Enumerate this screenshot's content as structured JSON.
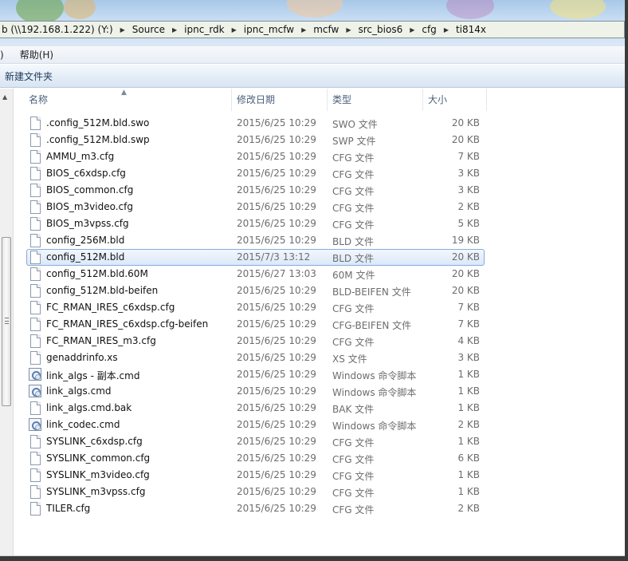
{
  "address": {
    "crumbs": [
      "b (\\\\192.168.1.222) (Y:)",
      "Source",
      "ipnc_rdk",
      "ipnc_mcfw",
      "mcfw",
      "src_bios6",
      "cfg",
      "ti814x"
    ]
  },
  "menu": {
    "partial": ")",
    "help": "帮助(H)"
  },
  "toolbar": {
    "new_folder": "新建文件夹"
  },
  "columns": {
    "name": "名称",
    "date": "修改日期",
    "type": "类型",
    "size": "大小"
  },
  "files": [
    {
      "name": ".config_512M.bld.swo",
      "date": "2015/6/25 10:29",
      "type": "SWO 文件",
      "size": "20 KB",
      "icon": "file-icon"
    },
    {
      "name": ".config_512M.bld.swp",
      "date": "2015/6/25 10:29",
      "type": "SWP 文件",
      "size": "20 KB",
      "icon": "file-icon"
    },
    {
      "name": "AMMU_m3.cfg",
      "date": "2015/6/25 10:29",
      "type": "CFG 文件",
      "size": "7 KB",
      "icon": "file-icon"
    },
    {
      "name": "BIOS_c6xdsp.cfg",
      "date": "2015/6/25 10:29",
      "type": "CFG 文件",
      "size": "3 KB",
      "icon": "file-icon"
    },
    {
      "name": "BIOS_common.cfg",
      "date": "2015/6/25 10:29",
      "type": "CFG 文件",
      "size": "3 KB",
      "icon": "file-icon"
    },
    {
      "name": "BIOS_m3video.cfg",
      "date": "2015/6/25 10:29",
      "type": "CFG 文件",
      "size": "2 KB",
      "icon": "file-icon"
    },
    {
      "name": "BIOS_m3vpss.cfg",
      "date": "2015/6/25 10:29",
      "type": "CFG 文件",
      "size": "5 KB",
      "icon": "file-icon"
    },
    {
      "name": "config_256M.bld",
      "date": "2015/6/25 10:29",
      "type": "BLD 文件",
      "size": "19 KB",
      "icon": "file-icon"
    },
    {
      "name": "config_512M.bld",
      "date": "2015/7/3 13:12",
      "type": "BLD 文件",
      "size": "20 KB",
      "icon": "file-icon",
      "selected": true
    },
    {
      "name": "config_512M.bld.60M",
      "date": "2015/6/27 13:03",
      "type": "60M 文件",
      "size": "20 KB",
      "icon": "file-icon"
    },
    {
      "name": "config_512M.bld-beifen",
      "date": "2015/6/25 10:29",
      "type": "BLD-BEIFEN 文件",
      "size": "20 KB",
      "icon": "file-icon"
    },
    {
      "name": "FC_RMAN_IRES_c6xdsp.cfg",
      "date": "2015/6/25 10:29",
      "type": "CFG 文件",
      "size": "7 KB",
      "icon": "file-icon"
    },
    {
      "name": "FC_RMAN_IRES_c6xdsp.cfg-beifen",
      "date": "2015/6/25 10:29",
      "type": "CFG-BEIFEN 文件",
      "size": "7 KB",
      "icon": "file-icon"
    },
    {
      "name": "FC_RMAN_IRES_m3.cfg",
      "date": "2015/6/25 10:29",
      "type": "CFG 文件",
      "size": "4 KB",
      "icon": "file-icon"
    },
    {
      "name": "genaddrinfo.xs",
      "date": "2015/6/25 10:29",
      "type": "XS 文件",
      "size": "3 KB",
      "icon": "file-icon"
    },
    {
      "name": "link_algs - 副本.cmd",
      "date": "2015/6/25 10:29",
      "type": "Windows 命令脚本",
      "size": "1 KB",
      "icon": "cmd-icon"
    },
    {
      "name": "link_algs.cmd",
      "date": "2015/6/25 10:29",
      "type": "Windows 命令脚本",
      "size": "1 KB",
      "icon": "cmd-icon"
    },
    {
      "name": "link_algs.cmd.bak",
      "date": "2015/6/25 10:29",
      "type": "BAK 文件",
      "size": "1 KB",
      "icon": "file-icon"
    },
    {
      "name": "link_codec.cmd",
      "date": "2015/6/25 10:29",
      "type": "Windows 命令脚本",
      "size": "2 KB",
      "icon": "cmd-icon"
    },
    {
      "name": "SYSLINK_c6xdsp.cfg",
      "date": "2015/6/25 10:29",
      "type": "CFG 文件",
      "size": "1 KB",
      "icon": "file-icon"
    },
    {
      "name": "SYSLINK_common.cfg",
      "date": "2015/6/25 10:29",
      "type": "CFG 文件",
      "size": "6 KB",
      "icon": "file-icon"
    },
    {
      "name": "SYSLINK_m3video.cfg",
      "date": "2015/6/25 10:29",
      "type": "CFG 文件",
      "size": "1 KB",
      "icon": "file-icon"
    },
    {
      "name": "SYSLINK_m3vpss.cfg",
      "date": "2015/6/25 10:29",
      "type": "CFG 文件",
      "size": "1 KB",
      "icon": "file-icon"
    },
    {
      "name": "TILER.cfg",
      "date": "2015/6/25 10:29",
      "type": "CFG 文件",
      "size": "2 KB",
      "icon": "file-icon"
    }
  ]
}
